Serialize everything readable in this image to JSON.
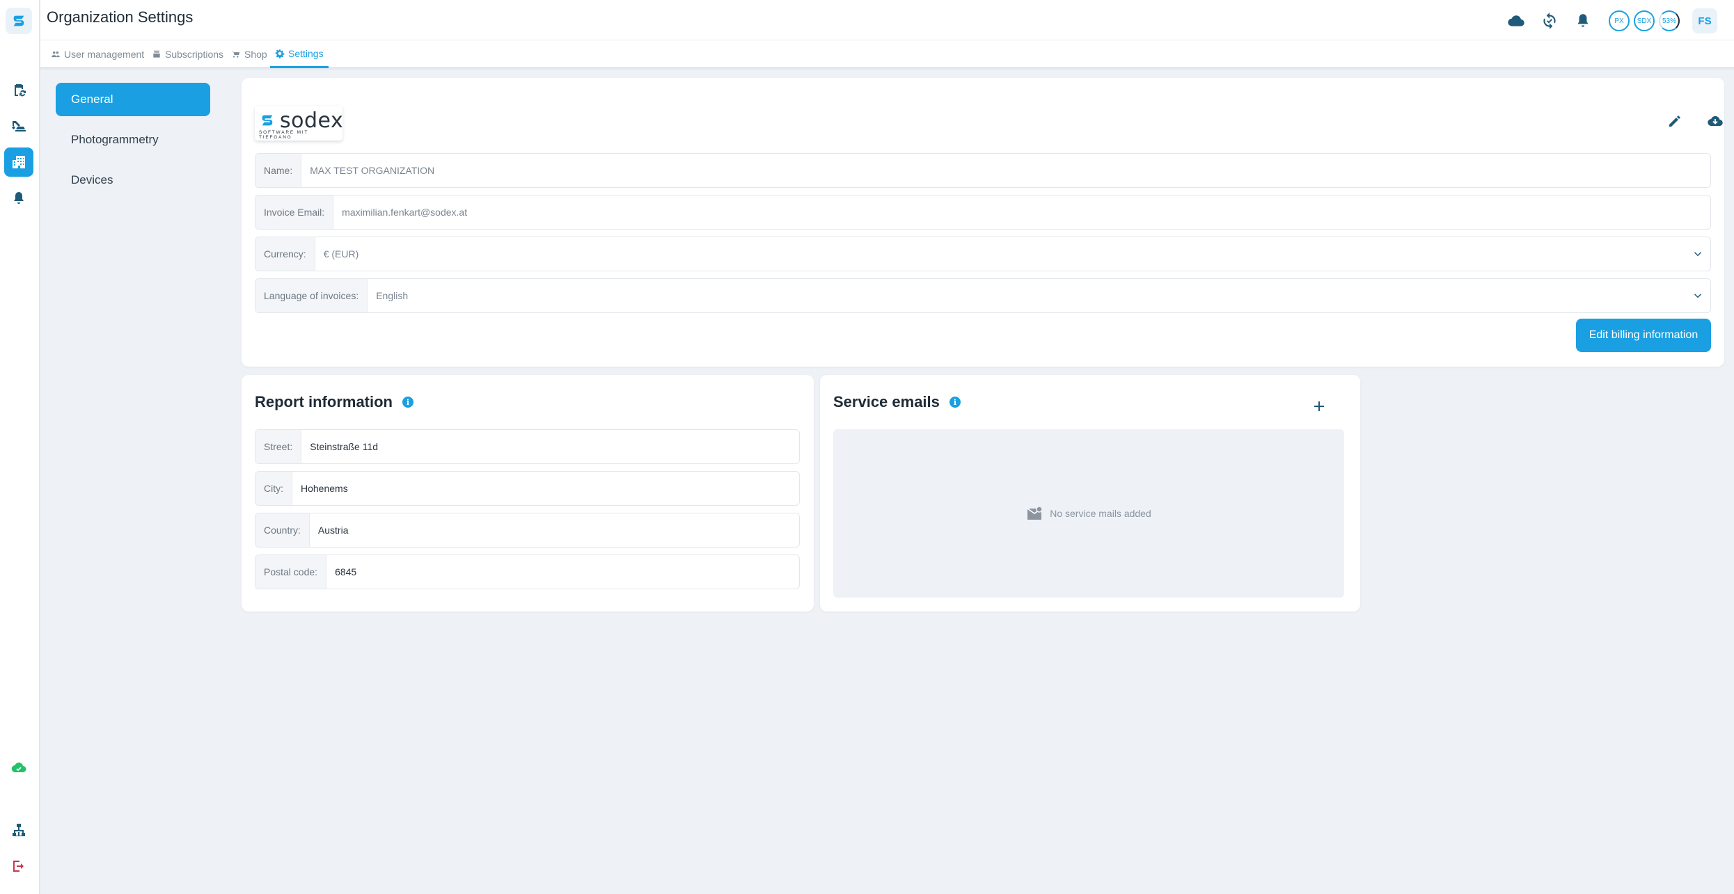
{
  "app": {
    "page_title": "Organization Settings",
    "brand_color": "#1aa0e2"
  },
  "rail": {
    "logo_icon": "sodex-logo-icon",
    "items": [
      {
        "name": "clipboard-sync-icon",
        "active": false
      },
      {
        "name": "excavator-icon",
        "active": false
      },
      {
        "name": "organization-icon",
        "active": true
      },
      {
        "name": "bell-icon",
        "active": false
      }
    ],
    "bottom": [
      {
        "name": "cloud-check-icon"
      },
      {
        "name": "network-icon"
      },
      {
        "name": "logout-icon"
      }
    ]
  },
  "header": {
    "icons": [
      "cloud-icon",
      "sync-icon",
      "notifications-icon"
    ],
    "rings": [
      "PX",
      "SDX",
      "53%"
    ],
    "avatar": "FS"
  },
  "tabs": [
    {
      "label": "User management",
      "icon": "users-icon"
    },
    {
      "label": "Subscriptions",
      "icon": "subscriptions-icon"
    },
    {
      "label": "Shop",
      "icon": "cart-icon"
    },
    {
      "label": "Settings",
      "icon": "gear-icon",
      "active": true
    }
  ],
  "sidenav": {
    "items": [
      {
        "label": "General",
        "active": true
      },
      {
        "label": "Photogrammetry"
      },
      {
        "label": "Devices"
      }
    ]
  },
  "billing": {
    "logo_word": "sodex",
    "logo_tagline": "SOFTWARE MIT TIEFGANG",
    "fields": {
      "name": {
        "label": "Name:",
        "value": "MAX TEST ORGANIZATION"
      },
      "invoice_email": {
        "label": "Invoice Email:",
        "value": "maximilian.fenkart@sodex.at"
      },
      "currency": {
        "label": "Currency:",
        "value": "€ (EUR)"
      },
      "language": {
        "label": "Language of invoices:",
        "value": "English"
      }
    },
    "edit_button": "Edit billing information"
  },
  "report": {
    "title": "Report information",
    "fields": {
      "street": {
        "label": "Street:",
        "value": "Steinstraße 11d"
      },
      "city": {
        "label": "City:",
        "value": "Hohenems"
      },
      "country": {
        "label": "Country:",
        "value": "Austria"
      },
      "postal": {
        "label": "Postal code:",
        "value": "6845"
      }
    }
  },
  "service": {
    "title": "Service emails",
    "empty_text": "No service mails added"
  }
}
